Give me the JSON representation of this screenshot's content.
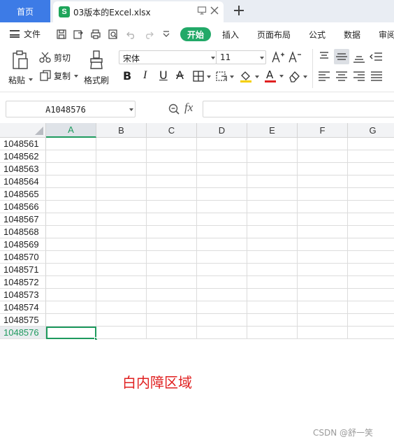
{
  "tabs": {
    "home_label": "首页",
    "file_label": "03版本的Excel.xlsx",
    "app_icon_letter": "S"
  },
  "menu": {
    "file_label": "文件",
    "items": [
      "开始",
      "插入",
      "页面布局",
      "公式",
      "数据",
      "审阅"
    ]
  },
  "ribbon": {
    "paste_label": "粘贴",
    "cut_label": "剪切",
    "copy_label": "复制",
    "format_painter_label": "格式刷",
    "font_name": "宋体",
    "font_size": "11",
    "increase_font_label": "A+",
    "decrease_font_label": "A-",
    "bold_label": "B",
    "italic_label": "I",
    "underline_label": "U",
    "strike_label": "A",
    "font_color_label": "A"
  },
  "formula_bar": {
    "cell_ref": "A1048576",
    "fx_label": "fx",
    "formula_value": ""
  },
  "sheet": {
    "columns": [
      "A",
      "B",
      "C",
      "D",
      "E",
      "F",
      "G"
    ],
    "rows": [
      "1048561",
      "1048562",
      "1048563",
      "1048564",
      "1048565",
      "1048566",
      "1048567",
      "1048568",
      "1048569",
      "1048570",
      "1048571",
      "1048572",
      "1048573",
      "1048574",
      "1048575",
      "1048576"
    ],
    "active_column": "A",
    "active_row": "1048576"
  },
  "annotation": {
    "blank_area_label": "白内障区域"
  },
  "watermark": "CSDN @舒一笑",
  "colors": {
    "accent_green": "#1e9a5e",
    "start_tab_green": "#22a968",
    "home_tab_blue": "#3d7be6",
    "annotation_red": "#e02020"
  }
}
